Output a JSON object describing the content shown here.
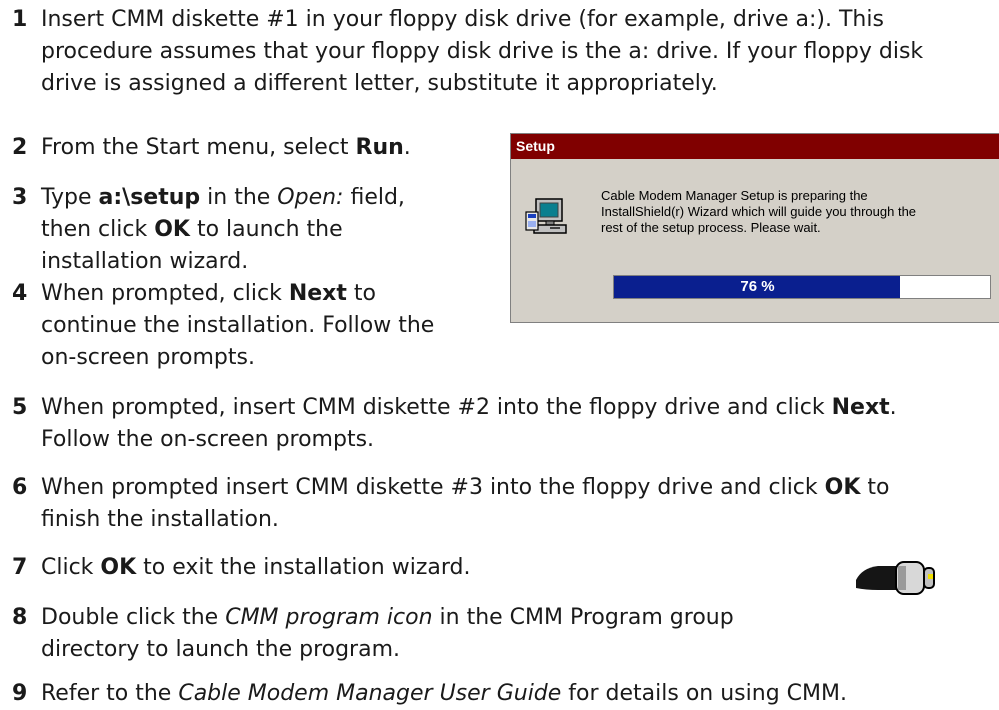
{
  "steps": [
    {
      "num": "1",
      "lines": [
        "Insert CMM diskette #1 in your floppy disk drive (for example, drive a:). This",
        "procedure assumes that your floppy disk drive is the a: drive. If your floppy disk",
        "drive is assigned a different letter, substitute it appropriately."
      ]
    },
    {
      "num": "2",
      "a": "From the Start menu, select ",
      "b": "Run",
      "c": "."
    },
    {
      "num": "3",
      "a": "Type ",
      "b": "a:\\setup",
      "c": " in the ",
      "d": "Open:",
      "e": " field,",
      "l2a": "then click ",
      "l2b": "OK",
      "l2c": " to launch the",
      "l3": "installation wizard."
    },
    {
      "num": "4",
      "a": "When prompted, click ",
      "b": "Next",
      "c": " to",
      "l2": "continue the installation. Follow the",
      "l3": "on-screen prompts."
    },
    {
      "num": "5",
      "a": "When prompted, insert CMM diskette #2 into the floppy drive and click ",
      "b": "Next",
      "c": ".",
      "l2": "Follow the on-screen prompts."
    },
    {
      "num": "6",
      "a": "When prompted insert CMM diskette #3 into the floppy drive and click ",
      "b": "OK",
      "c": " to",
      "l2": "finish the installation."
    },
    {
      "num": "7",
      "a": "Click ",
      "b": "OK",
      "c": " to exit the installation wizard."
    },
    {
      "num": "8",
      "a": "Double click the ",
      "b": "CMM program icon",
      "c": " in the CMM Program group",
      "l2": "directory to launch the program."
    },
    {
      "num": "9",
      "a": "Refer to the ",
      "b": "Cable Modem Manager User Guide",
      "c": " for details on using CMM."
    }
  ],
  "dialog": {
    "title": "Setup",
    "message_lines": [
      "Cable Modem Manager Setup is preparing the",
      "InstallShield(r) Wizard which will guide you through the",
      "rest of the setup process.  Please wait."
    ],
    "progress_label": "76 %",
    "progress_value": 0.76,
    "icon": "setup-computer-icon"
  },
  "program_icon": "cmm-program-icon",
  "colors": {
    "titlebar": "#800000",
    "dialog_bg": "#d4d0c8",
    "progress_fill": "#0a1f8f"
  }
}
